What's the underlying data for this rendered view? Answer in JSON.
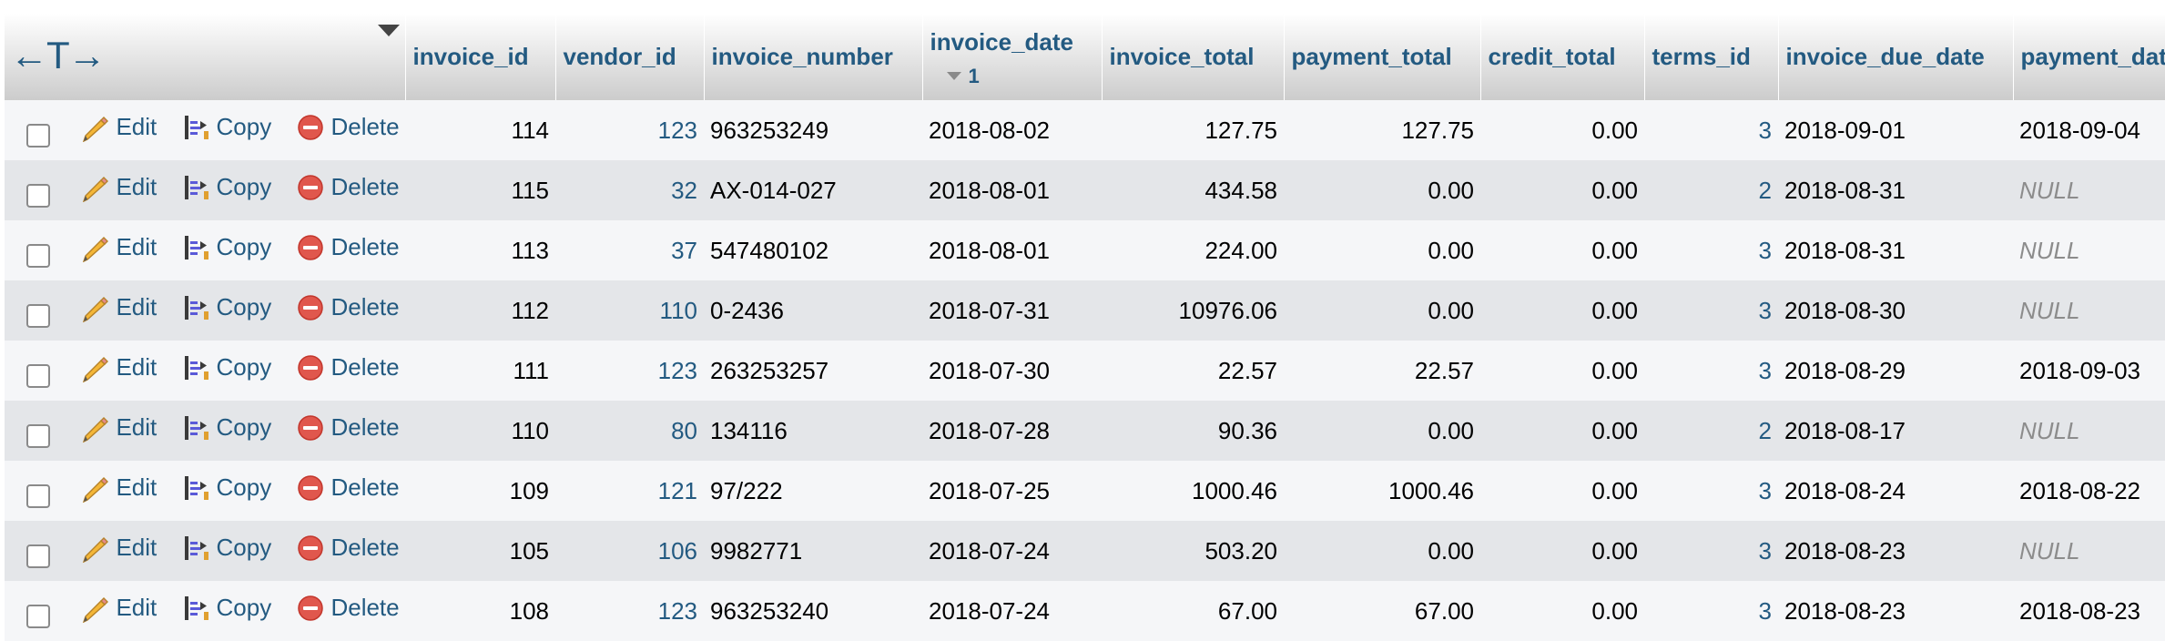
{
  "header": {
    "columns": [
      "invoice_id",
      "vendor_id",
      "invoice_number",
      "invoice_date",
      "invoice_total",
      "payment_total",
      "credit_total",
      "terms_id",
      "invoice_due_date",
      "payment_dat"
    ],
    "sort_index": "1",
    "column_mover_glyph": "←T→"
  },
  "actions": {
    "edit": "Edit",
    "copy": "Copy",
    "delete": "Delete"
  },
  "icons": [
    "pencil-icon",
    "copy-icon",
    "delete-icon",
    "sort-desc-icon"
  ],
  "colors": {
    "link": "#235a81",
    "row_odd": "#f5f6f8",
    "row_even": "#e4e6e9",
    "null_text": "#8c8c8c"
  },
  "rows": [
    {
      "invoice_id": "114",
      "vendor_id": "123",
      "invoice_number": "963253249",
      "invoice_date": "2018-08-02",
      "invoice_total": "127.75",
      "payment_total": "127.75",
      "credit_total": "0.00",
      "terms_id": "3",
      "invoice_due_date": "2018-09-01",
      "payment_date": "2018-09-04"
    },
    {
      "invoice_id": "115",
      "vendor_id": "32",
      "invoice_number": "AX-014-027",
      "invoice_date": "2018-08-01",
      "invoice_total": "434.58",
      "payment_total": "0.00",
      "credit_total": "0.00",
      "terms_id": "2",
      "invoice_due_date": "2018-08-31",
      "payment_date": "NULL"
    },
    {
      "invoice_id": "113",
      "vendor_id": "37",
      "invoice_number": "547480102",
      "invoice_date": "2018-08-01",
      "invoice_total": "224.00",
      "payment_total": "0.00",
      "credit_total": "0.00",
      "terms_id": "3",
      "invoice_due_date": "2018-08-31",
      "payment_date": "NULL"
    },
    {
      "invoice_id": "112",
      "vendor_id": "110",
      "invoice_number": "0-2436",
      "invoice_date": "2018-07-31",
      "invoice_total": "10976.06",
      "payment_total": "0.00",
      "credit_total": "0.00",
      "terms_id": "3",
      "invoice_due_date": "2018-08-30",
      "payment_date": "NULL"
    },
    {
      "invoice_id": "111",
      "vendor_id": "123",
      "invoice_number": "263253257",
      "invoice_date": "2018-07-30",
      "invoice_total": "22.57",
      "payment_total": "22.57",
      "credit_total": "0.00",
      "terms_id": "3",
      "invoice_due_date": "2018-08-29",
      "payment_date": "2018-09-03"
    },
    {
      "invoice_id": "110",
      "vendor_id": "80",
      "invoice_number": "134116",
      "invoice_date": "2018-07-28",
      "invoice_total": "90.36",
      "payment_total": "0.00",
      "credit_total": "0.00",
      "terms_id": "2",
      "invoice_due_date": "2018-08-17",
      "payment_date": "NULL"
    },
    {
      "invoice_id": "109",
      "vendor_id": "121",
      "invoice_number": "97/222",
      "invoice_date": "2018-07-25",
      "invoice_total": "1000.46",
      "payment_total": "1000.46",
      "credit_total": "0.00",
      "terms_id": "3",
      "invoice_due_date": "2018-08-24",
      "payment_date": "2018-08-22"
    },
    {
      "invoice_id": "105",
      "vendor_id": "106",
      "invoice_number": "9982771",
      "invoice_date": "2018-07-24",
      "invoice_total": "503.20",
      "payment_total": "0.00",
      "credit_total": "0.00",
      "terms_id": "3",
      "invoice_due_date": "2018-08-23",
      "payment_date": "NULL"
    },
    {
      "invoice_id": "108",
      "vendor_id": "123",
      "invoice_number": "963253240",
      "invoice_date": "2018-07-24",
      "invoice_total": "67.00",
      "payment_total": "67.00",
      "credit_total": "0.00",
      "terms_id": "3",
      "invoice_due_date": "2018-08-23",
      "payment_date": "2018-08-23"
    }
  ]
}
